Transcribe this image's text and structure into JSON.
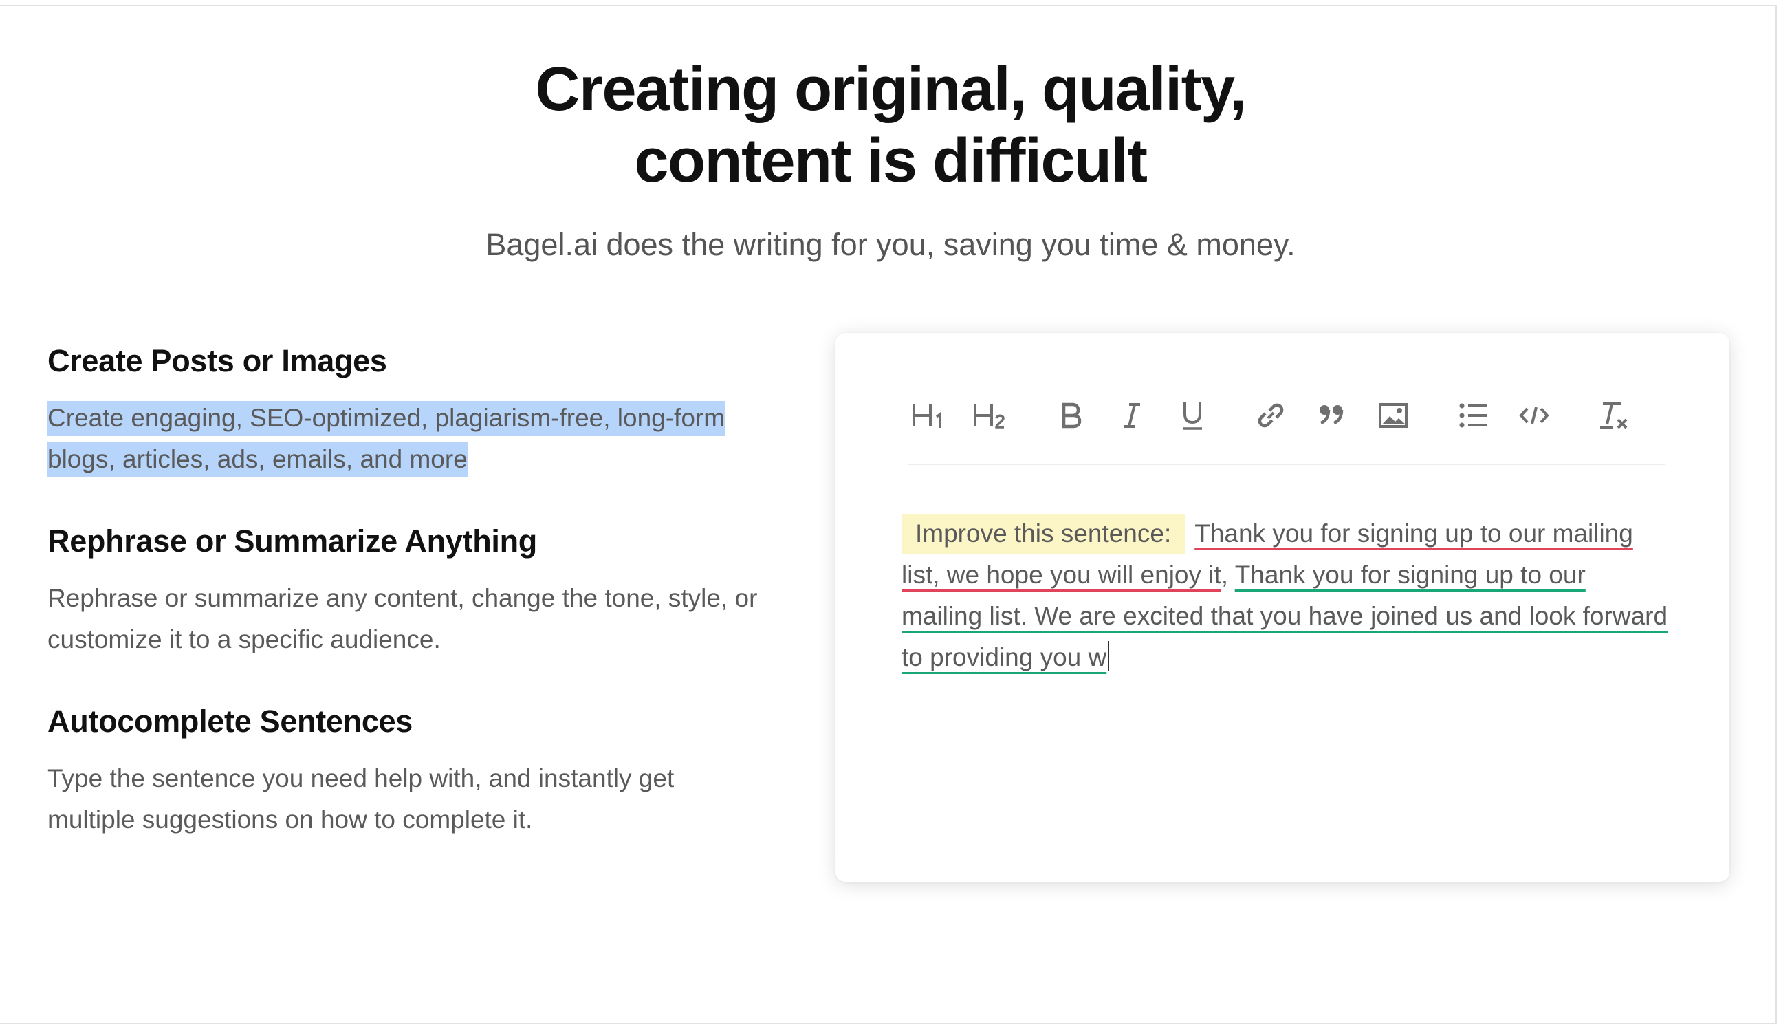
{
  "hero": {
    "title_line1": "Creating original, quality,",
    "title_line2": "content is difficult",
    "subtitle": "Bagel.ai does the writing for you, saving you time & money."
  },
  "features": [
    {
      "title": "Create Posts or Images",
      "description": "Create engaging, SEO-optimized, plagiarism-free, long-form blogs, articles, ads, emails, and more",
      "selected": true
    },
    {
      "title": "Rephrase or Summarize Anything",
      "description": "Rephrase or summarize any content, change the tone, style, or customize it to a specific audience."
    },
    {
      "title": "Autocomplete Sentences",
      "description": "Type the sentence you need help with, and instantly get multiple suggestions on how to complete it."
    }
  ],
  "editor": {
    "toolbar": [
      "heading-1-icon",
      "heading-2-icon",
      "bold-icon",
      "italic-icon",
      "underline-icon",
      "link-icon",
      "quote-icon",
      "image-icon",
      "bullet-list-icon",
      "code-icon",
      "clear-format-icon"
    ],
    "prompt_label": "Improve this sentence:",
    "original_text": "Thank you for signing up to our mailing list, we hope you will enjoy it",
    "separator": ",",
    "suggestion_text": "Thank you for signing up to our mailing list. We are excited that you have joined us and look forward to providing you w"
  },
  "colors": {
    "selection": "#b7d5fb",
    "prompt_highlight": "#fcf5c6",
    "underline_original": "#e0435a",
    "underline_suggestion": "#19a77a"
  }
}
